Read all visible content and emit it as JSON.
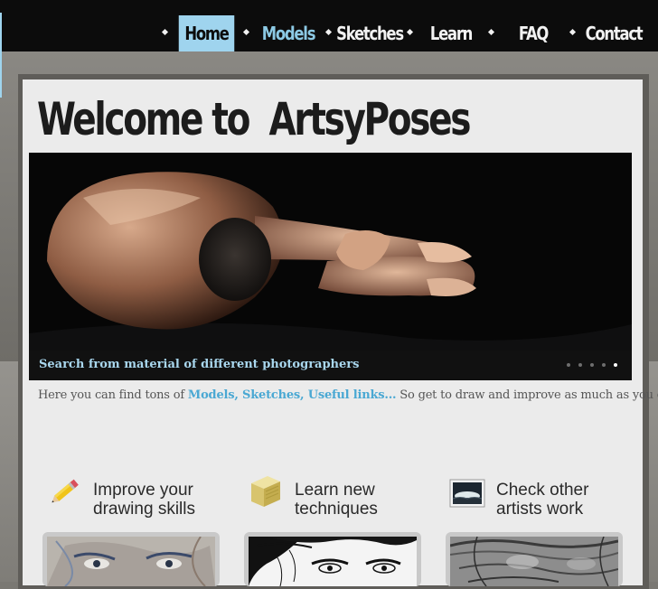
{
  "nav": {
    "items": [
      {
        "label": "Home",
        "active": true
      },
      {
        "label": "Models",
        "active": false
      },
      {
        "label": "Sketches",
        "active": false
      },
      {
        "label": "Learn",
        "active": false
      },
      {
        "label": "FAQ",
        "active": false
      },
      {
        "label": "Contact",
        "active": false
      }
    ]
  },
  "page": {
    "title": "Welcome to  ArtsyPoses"
  },
  "slider": {
    "caption": "Search from material of different photographers",
    "slide_count": 5,
    "active_slide": 5
  },
  "intro": {
    "before": "Here you can find tons of ",
    "link": "Models, Sketches, Useful links...",
    "after": " So get to draw and improve as much as you can"
  },
  "features": [
    {
      "title_line1": "Improve your",
      "title_line2": "drawing skills",
      "icon": "pencil-icon"
    },
    {
      "title_line1": "Learn new",
      "title_line2": "techniques",
      "icon": "book-icon"
    },
    {
      "title_line1": "Check other",
      "title_line2": "artists work",
      "icon": "picture-icon"
    }
  ],
  "colors": {
    "nav_background": "#0c0c0c",
    "nav_active": "#9fd4ee",
    "accent_link": "#4aa8d3",
    "panel": "#ebebeb"
  }
}
